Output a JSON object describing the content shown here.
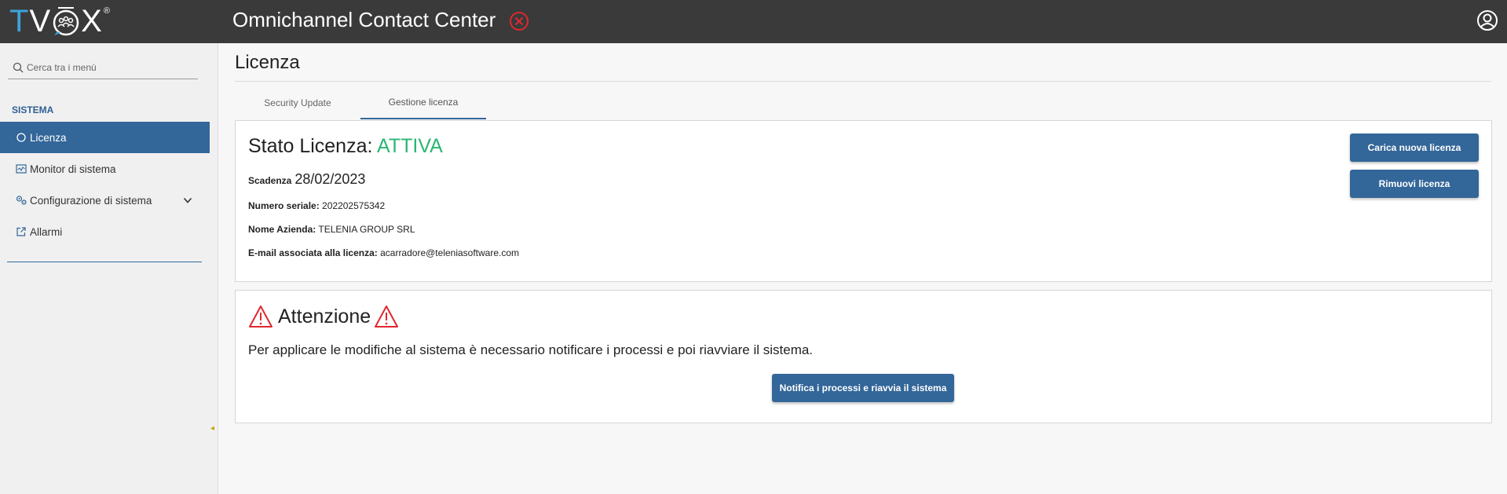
{
  "header": {
    "logo_text": "TVŌX",
    "logo_reg": "®",
    "app_title": "Omnichannel Contact Center",
    "accent_color": "#3ea3dc",
    "close_icon": "circle-x-icon",
    "user_icon": "user-circle-icon"
  },
  "sidebar": {
    "search_placeholder": "Cerca tra i menù",
    "section_title": "SISTEMA",
    "items": [
      {
        "label": "Licenza",
        "icon": "circle-icon",
        "active": true
      },
      {
        "label": "Monitor di sistema",
        "icon": "monitor-chart-icon",
        "active": false
      },
      {
        "label": "Configurazione di sistema",
        "icon": "gears-icon",
        "active": false,
        "expandable": true
      },
      {
        "label": "Allarmi",
        "icon": "external-link-icon",
        "active": false
      }
    ]
  },
  "main": {
    "page_title": "Licenza",
    "tabs": [
      {
        "label": "Security Update",
        "active": false
      },
      {
        "label": "Gestione licenza",
        "active": true
      }
    ],
    "license": {
      "stato_label": "Stato Licenza:",
      "stato_value": "ATTIVA",
      "scadenza_label": "Scadenza",
      "scadenza_value": "28/02/2023",
      "seriale_label": "Numero seriale:",
      "seriale_value": "202202575342",
      "azienda_label": "Nome Azienda:",
      "azienda_value": "TELENIA GROUP SRL",
      "email_label": "E-mail associata alla licenza:",
      "email_value": "acarradore@teleniasoftware.com",
      "upload_button": "Carica nuova licenza",
      "remove_button": "Rimuovi licenza",
      "status_color": "#2bb673"
    },
    "attention": {
      "title": "Attenzione",
      "message": "Per applicare le modifiche al sistema è necessario notificare i processi e poi riavviare il sistema.",
      "button": "Notifica i processi e riavvia il sistema",
      "warning_color": "#e0282e"
    }
  }
}
